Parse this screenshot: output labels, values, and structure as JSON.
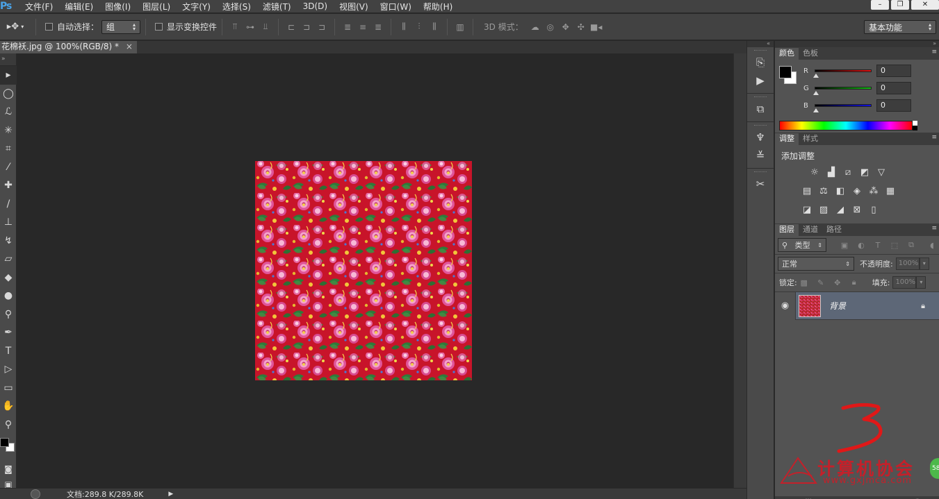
{
  "app": {
    "logo": "Ps",
    "menu": [
      "文件(F)",
      "编辑(E)",
      "图像(I)",
      "图层(L)",
      "文字(Y)",
      "选择(S)",
      "滤镜(T)",
      "3D(D)",
      "视图(V)",
      "窗口(W)",
      "帮助(H)"
    ],
    "window_buttons": [
      "minimize",
      "restore",
      "close"
    ]
  },
  "options": {
    "auto_select_label": "自动选择：",
    "auto_select_value": "组",
    "show_transform_label": "显示变换控件",
    "mode3d_label": "3D 模式：",
    "workspace": "基本功能"
  },
  "document": {
    "tab_title": "花棉袄.jpg @ 100%(RGB/8) *",
    "status_info": "文档:289.8 K/289.8K"
  },
  "color_panel": {
    "tabs": [
      "颜色",
      "色板"
    ],
    "r_label": "R",
    "g_label": "G",
    "b_label": "B",
    "r_value": "0",
    "g_value": "0",
    "b_value": "0",
    "accent_r": "#e01010",
    "accent_g": "#10c010",
    "accent_b": "#1010e0"
  },
  "adjustments_panel": {
    "tabs": [
      "调整",
      "样式"
    ],
    "title": "添加调整"
  },
  "layers_panel": {
    "tabs": [
      "图层",
      "通道",
      "路径"
    ],
    "filter_kind": "类型",
    "blend_mode": "正常",
    "opacity_label": "不透明度:",
    "opacity_value": "100%",
    "lock_label": "锁定:",
    "fill_label": "填充:",
    "fill_value": "100%",
    "layer_name": "背景"
  },
  "annotation": {
    "mark": "3"
  },
  "watermark": {
    "title": "计算机协会",
    "url": "www.gxjmca.com",
    "badge": "58"
  }
}
